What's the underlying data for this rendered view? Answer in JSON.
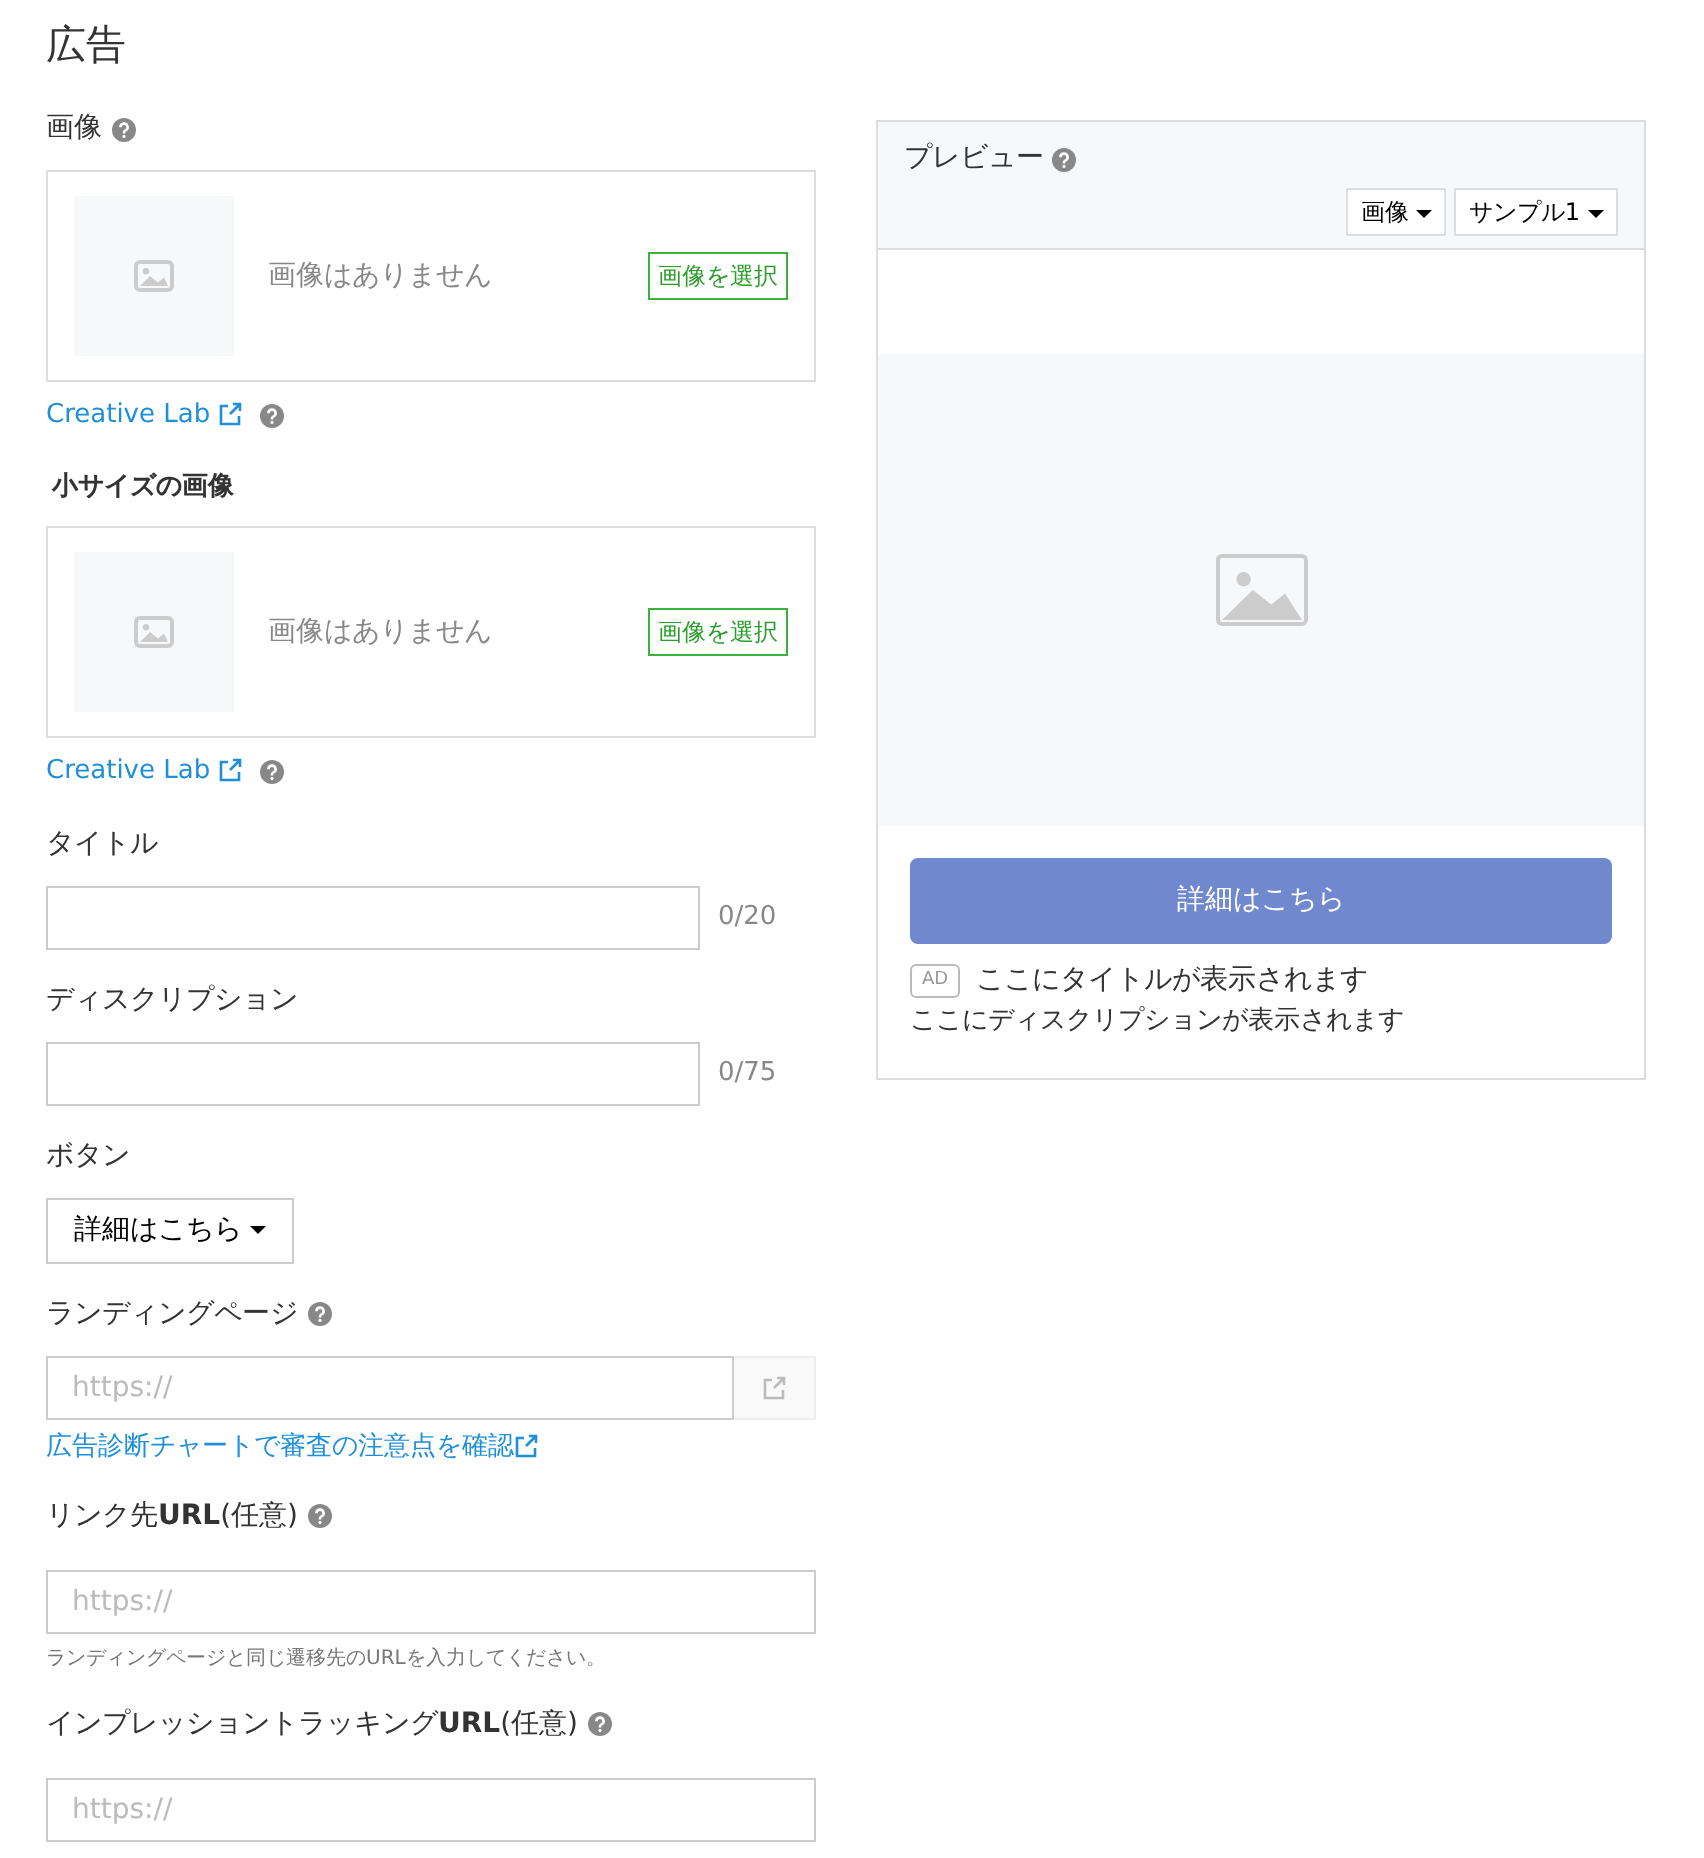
{
  "page_title": "広告",
  "fields": [
    {
      "kind": "image",
      "label": "画像",
      "strong": false,
      "help": true,
      "empty_text": "画像はありません",
      "select_button": "画像を選択",
      "link": "Creative Lab"
    },
    {
      "kind": "image",
      "label": "小サイズの画像",
      "strong": true,
      "help": false,
      "empty_text": "画像はありません",
      "select_button": "画像を選択",
      "link": "Creative Lab"
    },
    {
      "kind": "text",
      "label": "タイトル",
      "help": false,
      "counter": "0/20"
    },
    {
      "kind": "text",
      "label": "ディスクリプション",
      "help": false,
      "counter": "0/75"
    },
    {
      "kind": "dropdown",
      "label": "ボタン",
      "help": false,
      "value": "詳細はこちら"
    },
    {
      "kind": "url",
      "label": "ランディングページ",
      "help": true,
      "placeholder": "https://",
      "link": "広告診断チャートで審査の注意点を確認"
    },
    {
      "kind": "plain",
      "label": "リンク先**URL**(任意)",
      "help": true,
      "placeholder": "https://",
      "hint": "ランディングページと同じ遷移先のURLを入力してください。"
    },
    {
      "kind": "plain",
      "label": "インプレッショントラッキング**URL**(任意)",
      "help": true,
      "placeholder": "https://"
    }
  ],
  "preview": {
    "title": "プレビュー",
    "dropdowns": [
      "画像",
      "サンプル1"
    ],
    "cta": "詳細はこちら",
    "ad_badge": "AD",
    "ad_title": "ここにタイトルが表示されます",
    "ad_description": "ここにディスクリプションが表示されます"
  }
}
